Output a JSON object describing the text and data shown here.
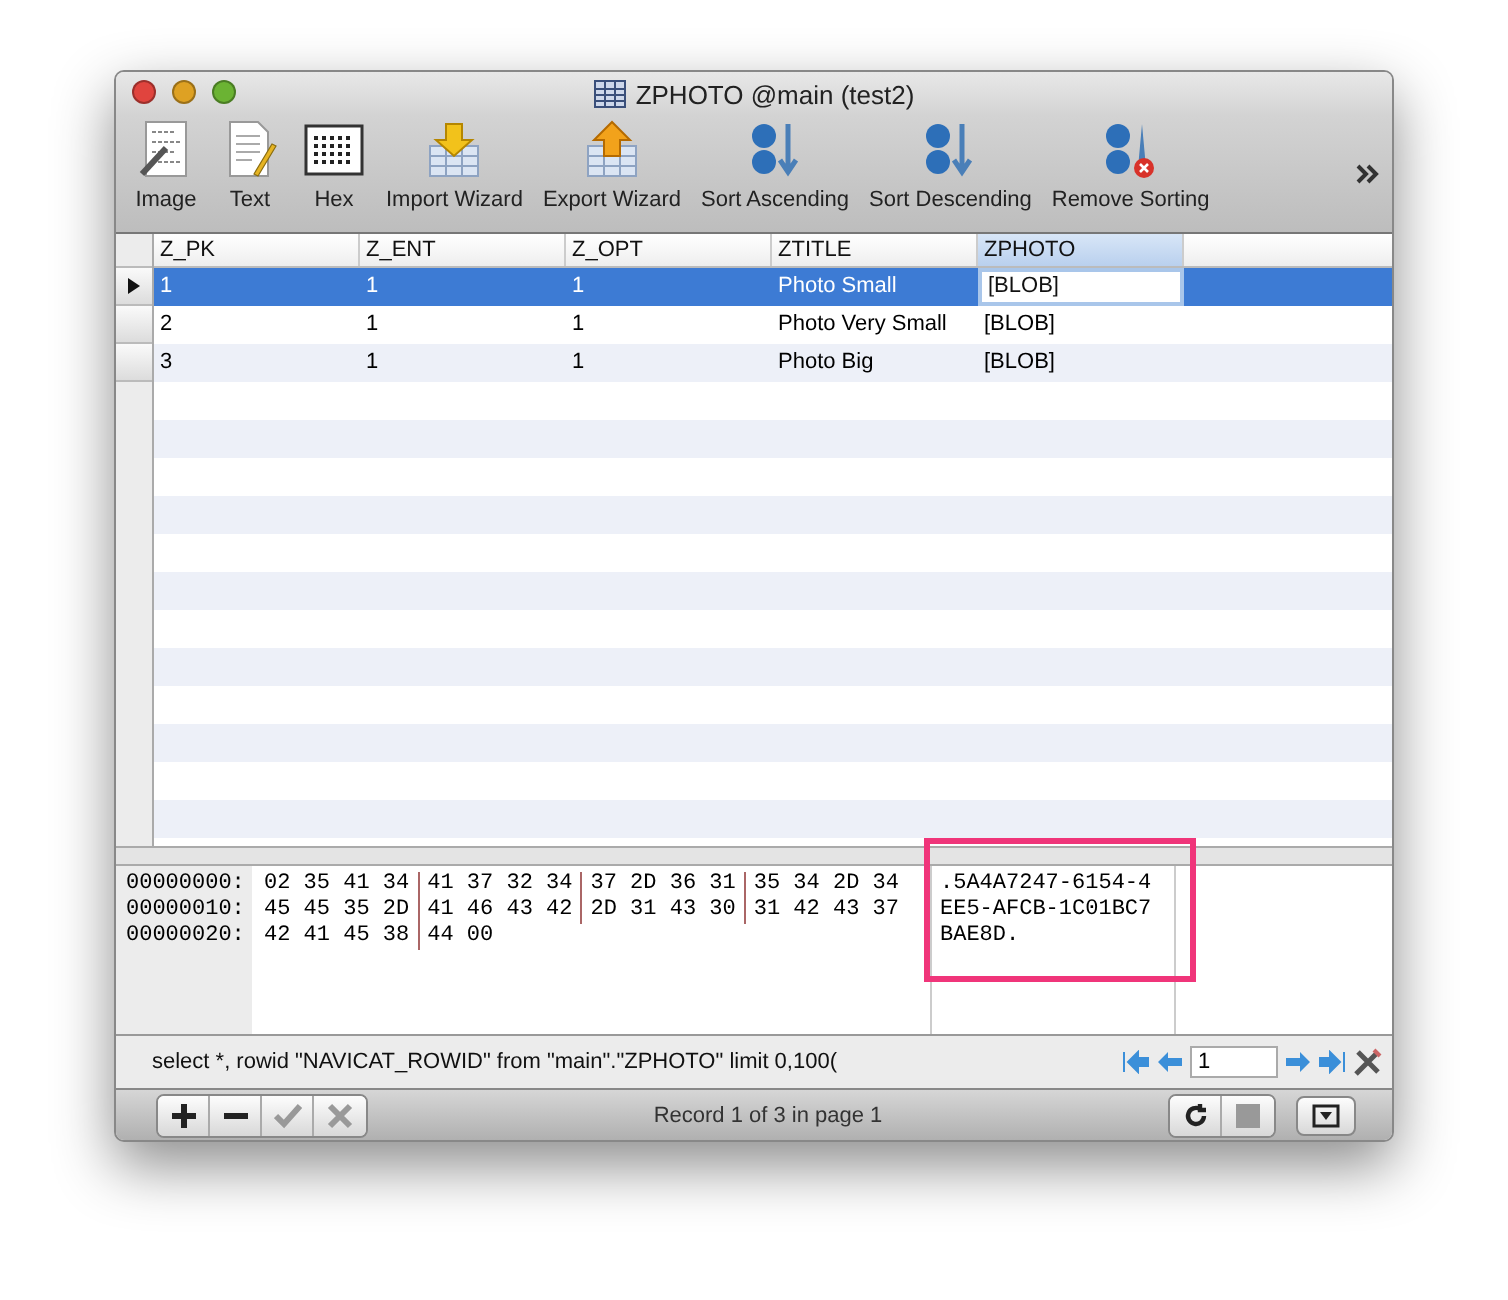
{
  "window": {
    "title": "ZPHOTO @main (test2)"
  },
  "toolbar": [
    {
      "kind": "image",
      "label": "Image"
    },
    {
      "kind": "text",
      "label": "Text"
    },
    {
      "kind": "hex",
      "label": "Hex"
    },
    {
      "kind": "import",
      "label": "Import Wizard"
    },
    {
      "kind": "export",
      "label": "Export Wizard"
    },
    {
      "kind": "sort-asc",
      "label": "Sort Ascending"
    },
    {
      "kind": "sort-desc",
      "label": "Sort Descending"
    },
    {
      "kind": "sort-remove",
      "label": "Remove Sorting"
    }
  ],
  "table": {
    "columns": [
      {
        "label": "Z_PK",
        "selected": false
      },
      {
        "label": "Z_ENT",
        "selected": false
      },
      {
        "label": "Z_OPT",
        "selected": false
      },
      {
        "label": "ZTITLE",
        "selected": false
      },
      {
        "label": "ZPHOTO",
        "selected": true
      }
    ],
    "rows": [
      {
        "selected": true,
        "editing": true,
        "cells": [
          "1",
          "1",
          "1",
          "Photo Small",
          "[BLOB]"
        ]
      },
      {
        "selected": false,
        "editing": false,
        "cells": [
          "2",
          "1",
          "1",
          "Photo Very Small",
          "[BLOB]"
        ]
      },
      {
        "selected": false,
        "editing": false,
        "cells": [
          "3",
          "1",
          "1",
          "Photo Big",
          "[BLOB]"
        ]
      }
    ]
  },
  "hex": {
    "lines": [
      {
        "offset": "00000000:",
        "groups": [
          "02 35 41 34",
          "41 37 32 34",
          "37 2D 36 31",
          "35 34 2D 34"
        ],
        "ascii": ".5A4A7247-6154-4"
      },
      {
        "offset": "00000010:",
        "groups": [
          "45 45 35 2D",
          "41 46 43 42",
          "2D 31 43 30",
          "31 42 43 37"
        ],
        "ascii": "EE5-AFCB-1C01BC7"
      },
      {
        "offset": "00000020:",
        "groups": [
          "42 41 45 38",
          "44 00"
        ],
        "ascii": "BAE8D."
      }
    ],
    "highlight": true
  },
  "status": {
    "query": "select *, rowid \"NAVICAT_ROWID\" from \"main\".\"ZPHOTO\"  limit 0,100(",
    "page": "1"
  },
  "footer": {
    "left_buttons": [
      {
        "kind": "plus",
        "disabled": false
      },
      {
        "kind": "minus",
        "disabled": false
      },
      {
        "kind": "check",
        "disabled": true
      },
      {
        "kind": "cross",
        "disabled": true
      }
    ],
    "record": "Record 1 of 3 in page 1",
    "right_buttons": [
      {
        "kind": "refresh",
        "disabled": false
      },
      {
        "kind": "stop",
        "disabled": true
      }
    ]
  }
}
